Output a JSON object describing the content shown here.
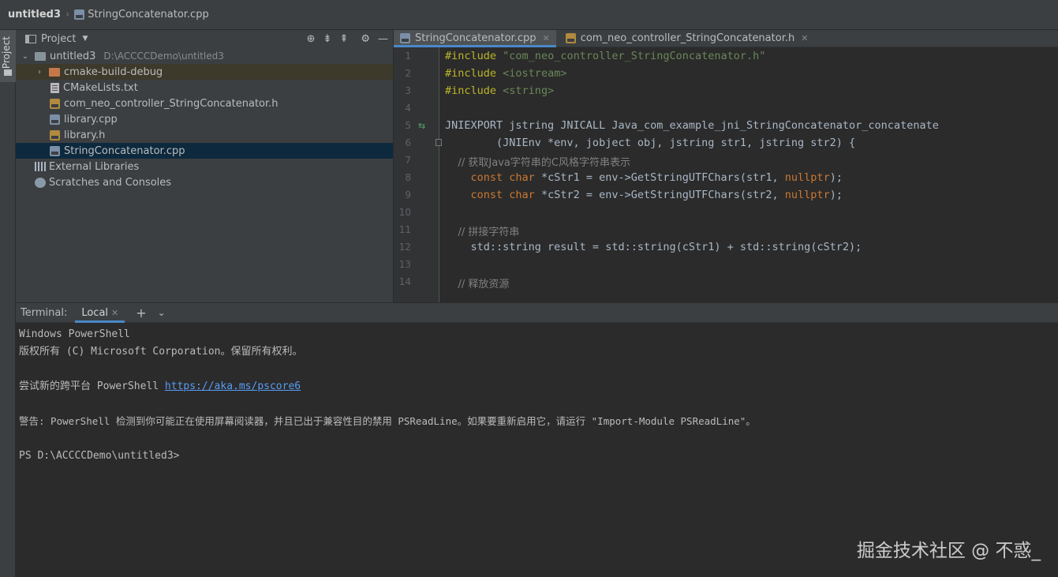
{
  "breadcrumb": {
    "project": "untitled3",
    "file": "StringConcatenator.cpp"
  },
  "left_tool": {
    "project_tab": "Project"
  },
  "project_panel": {
    "title": "Project",
    "tree": [
      {
        "label": "untitled3",
        "path": "D:\\ACCCCDemo\\untitled3",
        "icon": "folder-icon"
      },
      {
        "label": "cmake-build-debug",
        "icon": "folder-orange-icon"
      },
      {
        "label": "CMakeLists.txt",
        "icon": "text-file-icon"
      },
      {
        "label": "com_neo_controller_StringConcatenator.h",
        "icon": "header-file-icon"
      },
      {
        "label": "library.cpp",
        "icon": "cpp-file-icon"
      },
      {
        "label": "library.h",
        "icon": "header-file-icon"
      },
      {
        "label": "StringConcatenator.cpp",
        "icon": "cpp-file-icon"
      },
      {
        "label": "External Libraries",
        "icon": "library-icon"
      },
      {
        "label": "Scratches and Consoles",
        "icon": "scratches-icon"
      }
    ]
  },
  "editor": {
    "tabs": [
      {
        "label": "StringConcatenator.cpp",
        "active": true
      },
      {
        "label": "com_neo_controller_StringConcatenator.h",
        "active": false
      }
    ],
    "line_numbers": [
      "1",
      "2",
      "3",
      "4",
      "5",
      "6",
      "7",
      "8",
      "9",
      "10",
      "11",
      "12",
      "13",
      "14"
    ],
    "code": {
      "l1a": "#include",
      "l1b": "\"com_neo_controller_StringConcatenator.h\"",
      "l2a": "#include",
      "l2b": "<iostream>",
      "l3a": "#include",
      "l3b": "<string>",
      "l5": "JNIEXPORT jstring JNICALL Java_com_example_jni_StringConcatenator_concatenate",
      "l6": "        (JNIEnv *env, jobject obj, jstring str1, jstring str2) {",
      "l7": "    // 获取Java字符串的C风格字符串表示",
      "l8a": "    ",
      "l8kw1": "const",
      "l8kw2": "char",
      "l8b": " *cStr1 = env->GetStringUTFChars(str1, ",
      "l8n": "nullptr",
      "l8c": ");",
      "l9kw1": "const",
      "l9kw2": "char",
      "l9b": " *cStr2 = env->GetStringUTFChars(str2, ",
      "l9n": "nullptr",
      "l9c": ");",
      "l11": "    // 拼接字符串",
      "l12": "    std::string result = std::string(cStr1) + std::string(cStr2);",
      "l14": "    // 释放资源"
    }
  },
  "terminal": {
    "label": "Terminal:",
    "tab": "Local",
    "lines": {
      "l1": "Windows PowerShell",
      "l2": "版权所有 (C) Microsoft Corporation。保留所有权利。",
      "l3a": "尝试新的跨平台 PowerShell ",
      "l3link": "https://aka.ms/pscore6",
      "l4": "警告: PowerShell 检测到你可能正在使用屏幕阅读器，并且已出于兼容性目的禁用 PSReadLine。如果要重新启用它，请运行 \"Import-Module PSReadLine\"。",
      "l5": "PS D:\\ACCCCDemo\\untitled3>"
    }
  },
  "watermark": "掘金技术社区 @ 不惑_"
}
